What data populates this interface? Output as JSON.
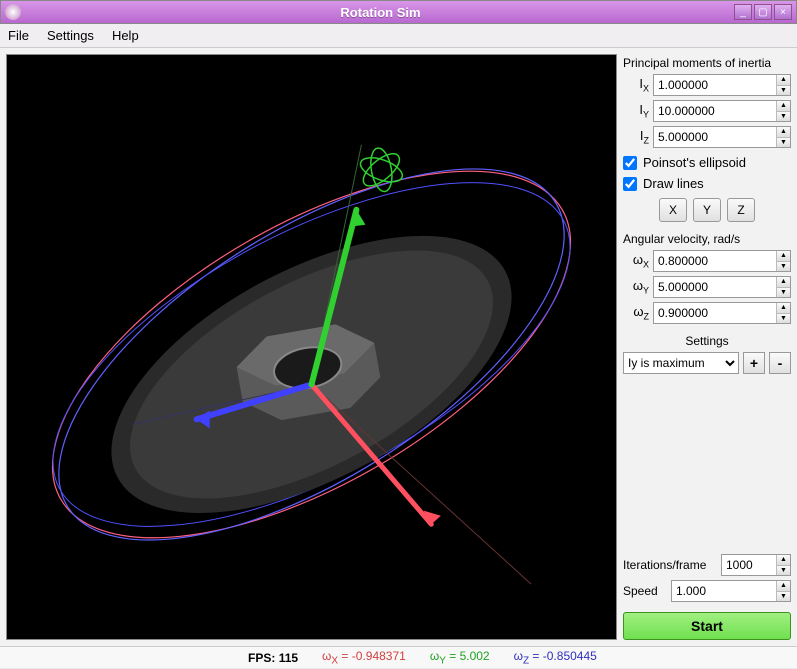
{
  "window": {
    "title": "Rotation Sim"
  },
  "menu": {
    "file": "File",
    "settings": "Settings",
    "help": "Help"
  },
  "panel": {
    "inertia": {
      "heading": "Principal moments of inertia",
      "ix_label": "I",
      "ix_sub": "X",
      "ix": "1.000000",
      "iy_label": "I",
      "iy_sub": "Y",
      "iy": "10.000000",
      "iz_label": "I",
      "iz_sub": "Z",
      "iz": "5.000000"
    },
    "poinsot": "Poinsot's ellipsoid",
    "drawlines": "Draw lines",
    "axisbtn": {
      "x": "X",
      "y": "Y",
      "z": "Z"
    },
    "angvel": {
      "heading": "Angular velocity, rad/s",
      "wx_label": "ω",
      "wx_sub": "X",
      "wx": "0.800000",
      "wy_label": "ω",
      "wy_sub": "Y",
      "wy": "5.000000",
      "wz_label": "ω",
      "wz_sub": "Z",
      "wz": "0.900000"
    },
    "settings_label": "Settings",
    "preset": "Iy is maximum",
    "plus": "+",
    "minus": "-",
    "iter_label": "Iterations/frame",
    "iter": "1000",
    "speed_label": "Speed",
    "speed": "1.000",
    "start": "Start"
  },
  "status": {
    "fps_label": "FPS:",
    "fps": "115",
    "wx_lbl": "ω",
    "wx_sub": "X",
    "wx_eq": " = ",
    "wx": "-0.948371",
    "wy_lbl": "ω",
    "wy_sub": "Y",
    "wy_eq": " = ",
    "wy": "5.002",
    "wz_lbl": "ω",
    "wz_sub": "Z",
    "wz_eq": " = ",
    "wz": "-0.850445"
  }
}
